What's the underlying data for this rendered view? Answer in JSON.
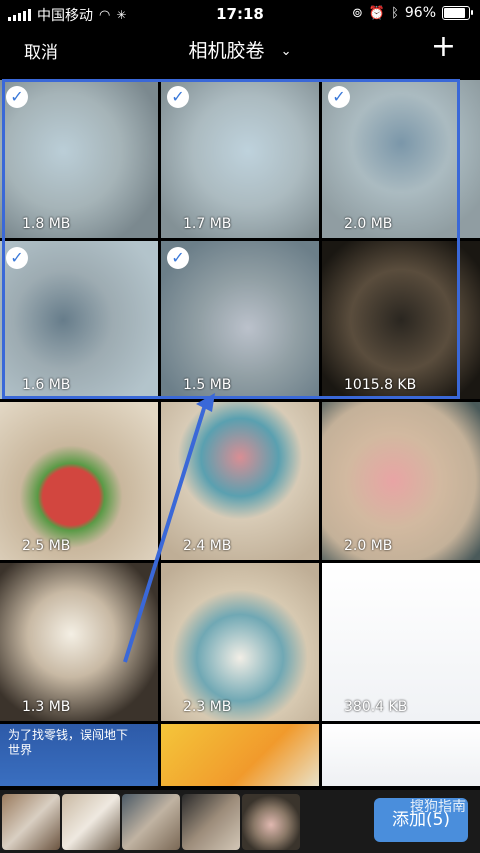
{
  "status": {
    "carrier": "中国移动",
    "time": "17:18",
    "battery": "96%",
    "battery_level": 0.96
  },
  "nav": {
    "cancel": "取消",
    "title": "相机胶卷",
    "chevron": "chevron-down-icon",
    "add": "plus-icon"
  },
  "photos": [
    {
      "size": "1.8 MB",
      "selected": true
    },
    {
      "size": "1.7 MB",
      "selected": true
    },
    {
      "size": "2.0 MB",
      "selected": true
    },
    {
      "size": "1.6 MB",
      "selected": true
    },
    {
      "size": "1.5 MB",
      "selected": true
    },
    {
      "size": "1015.8 KB",
      "selected": false
    },
    {
      "size": "2.5 MB",
      "selected": false
    },
    {
      "size": "2.4 MB",
      "selected": false
    },
    {
      "size": "2.0 MB",
      "selected": false
    },
    {
      "size": "1.3 MB",
      "selected": false
    },
    {
      "size": "2.3 MB",
      "selected": false
    },
    {
      "size": "380.4 KB",
      "selected": false
    }
  ],
  "screenshot_tile": {
    "text": "为了找零钱，误闯地下世界"
  },
  "tray": {
    "add_label": "添加(5)",
    "watermark": "搜狗指南"
  },
  "colors": {
    "accent": "#3a68d8",
    "button": "#4a8edc"
  }
}
